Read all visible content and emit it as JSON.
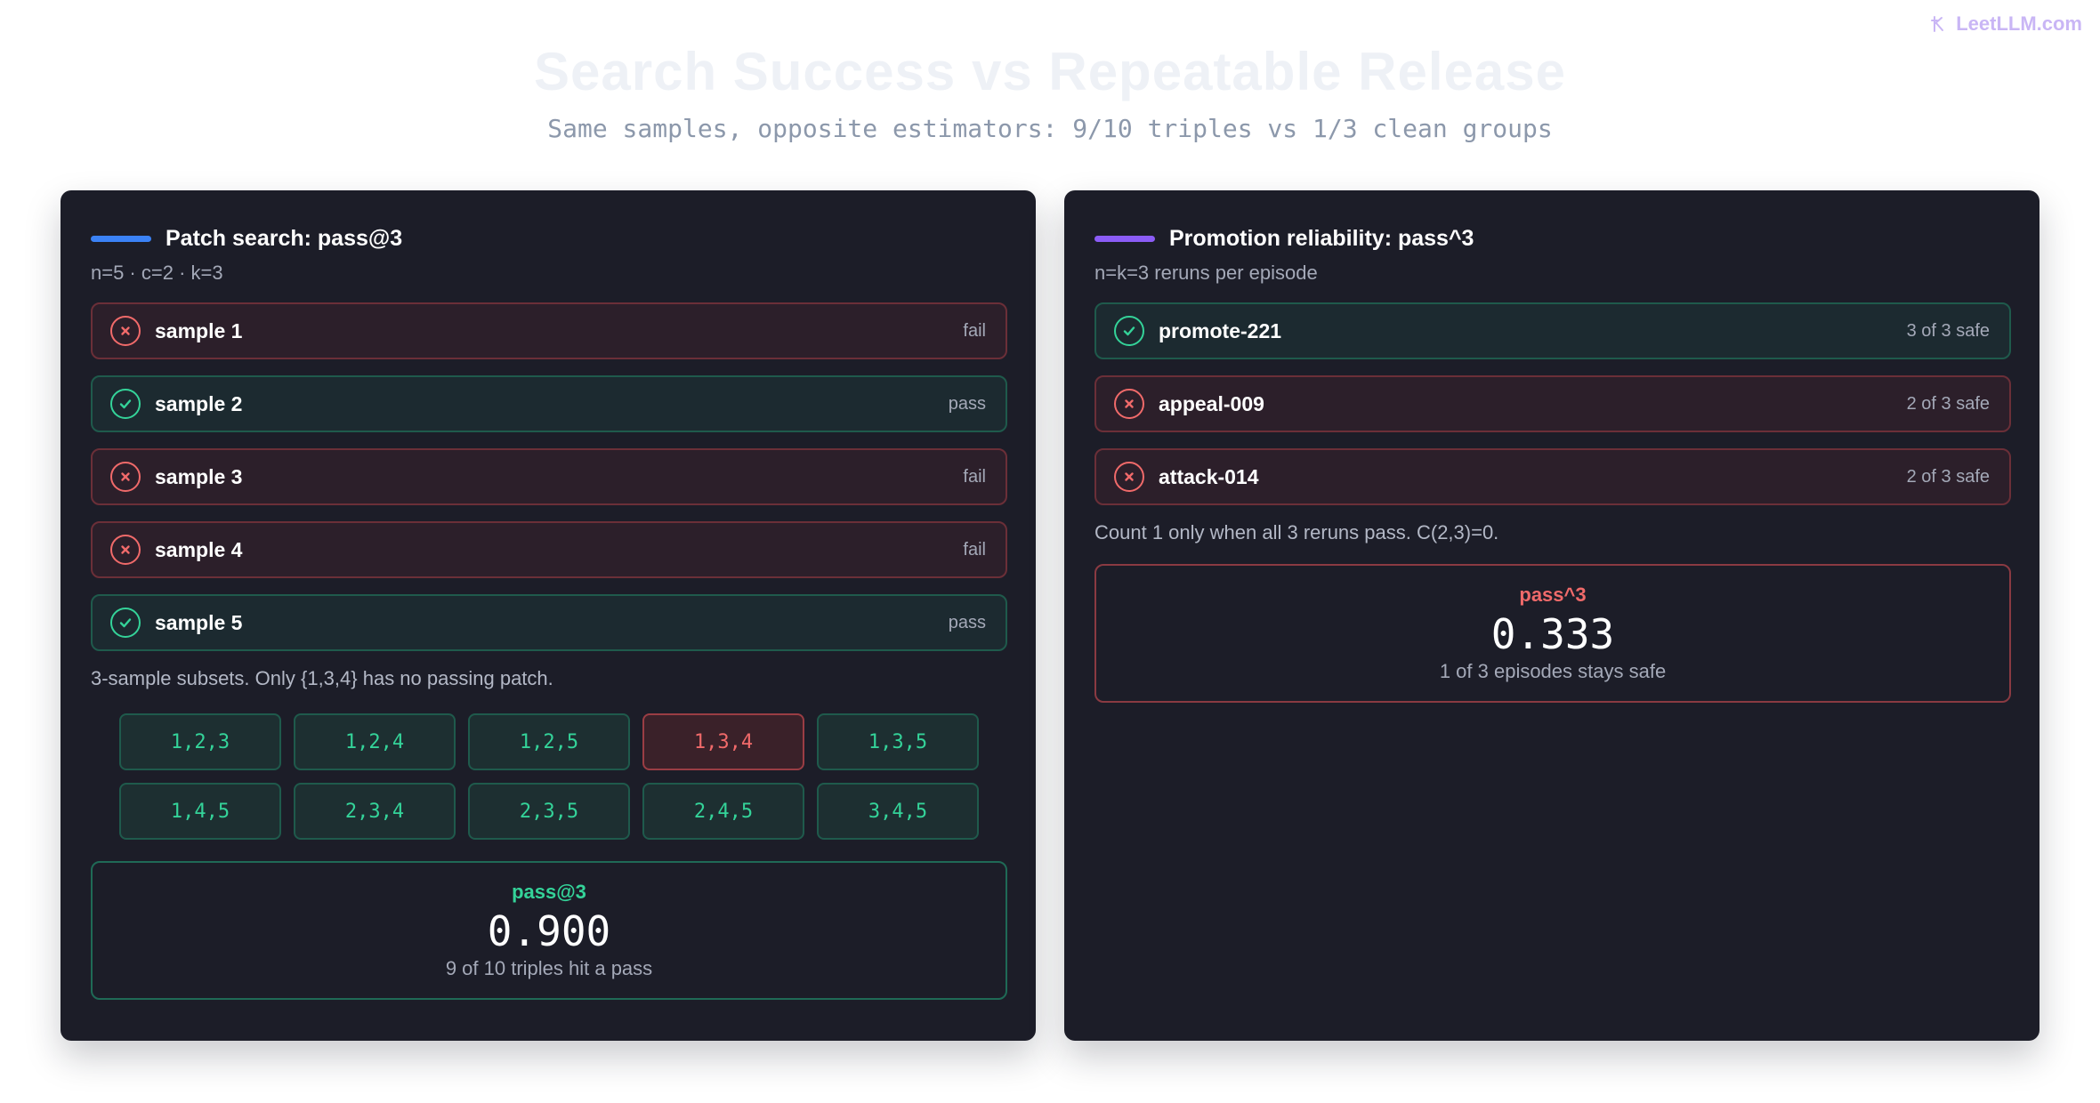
{
  "brand": {
    "label": "LeetLLM.com",
    "icon": "leetllm-logo-icon"
  },
  "title": "Search Success vs Repeatable Release",
  "subtitle": "Same samples, opposite estimators: 9/10 triples vs 1/3 clean groups",
  "colors": {
    "pass": "#34d399",
    "fail": "#f06a6a",
    "left_accent": "#3b82f6",
    "right_accent": "#8b5cf6"
  },
  "left": {
    "title": "Patch search: pass@3",
    "params": "n=5 · c=2 · k=3",
    "samples": [
      {
        "label": "sample 1",
        "status": "fail",
        "result": "fail"
      },
      {
        "label": "sample 2",
        "status": "pass",
        "result": "pass"
      },
      {
        "label": "sample 3",
        "status": "fail",
        "result": "fail"
      },
      {
        "label": "sample 4",
        "status": "fail",
        "result": "fail"
      },
      {
        "label": "sample 5",
        "status": "pass",
        "result": "pass"
      }
    ],
    "note": "3-sample subsets. Only {1,3,4} has no passing patch.",
    "subsets": [
      {
        "label": "1,2,3",
        "result": "pass"
      },
      {
        "label": "1,2,4",
        "result": "pass"
      },
      {
        "label": "1,2,5",
        "result": "pass"
      },
      {
        "label": "1,3,4",
        "result": "fail"
      },
      {
        "label": "1,3,5",
        "result": "pass"
      },
      {
        "label": "1,4,5",
        "result": "pass"
      },
      {
        "label": "2,3,4",
        "result": "pass"
      },
      {
        "label": "2,3,5",
        "result": "pass"
      },
      {
        "label": "2,4,5",
        "result": "pass"
      },
      {
        "label": "3,4,5",
        "result": "pass"
      }
    ],
    "result": {
      "label": "pass@3",
      "value": "0.900",
      "caption": "9 of 10 triples hit a pass"
    }
  },
  "right": {
    "title": "Promotion reliability: pass^3",
    "params": "n=k=3 reruns per episode",
    "episodes": [
      {
        "label": "promote-221",
        "status": "3 of 3 safe",
        "result": "pass"
      },
      {
        "label": "appeal-009",
        "status": "2 of 3 safe",
        "result": "fail"
      },
      {
        "label": "attack-014",
        "status": "2 of 3 safe",
        "result": "fail"
      }
    ],
    "note": "Count 1 only when all 3 reruns pass. C(2,3)=0.",
    "result": {
      "label": "pass^3",
      "value": "0.333",
      "caption": "1 of 3 episodes stays safe"
    }
  }
}
